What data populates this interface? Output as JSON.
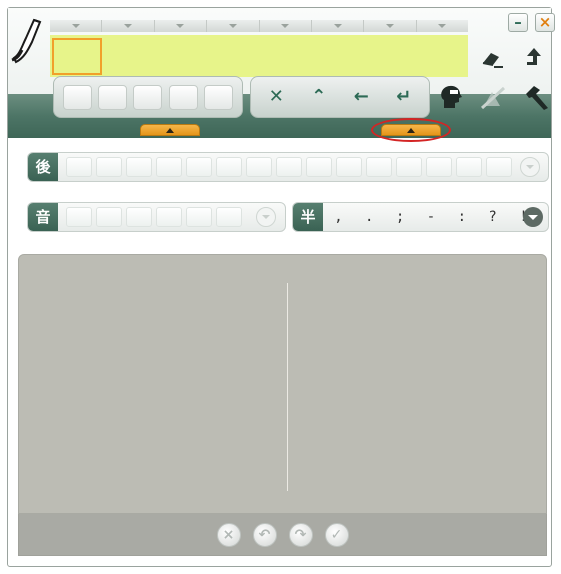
{
  "window": {
    "minimize_label": "–",
    "close_label": "×"
  },
  "candidate_tabs": [
    "",
    "",
    "",
    "",
    "",
    "",
    "",
    ""
  ],
  "input_bar": {
    "value": ""
  },
  "toolbar": {
    "keys": [
      "",
      "",
      "",
      "",
      ""
    ],
    "controls": [
      {
        "glyph": "✕",
        "name": "clear-key"
      },
      {
        "glyph": "⌃",
        "name": "caret-key"
      },
      {
        "glyph": "←",
        "name": "backspace-key"
      },
      {
        "glyph": "↵",
        "name": "enter-key"
      }
    ]
  },
  "rows": {
    "row1_label": "後",
    "row2_label": "音",
    "row2b_label": "半",
    "punctuation": [
      ",",
      ".",
      ";",
      "-",
      ":",
      "?",
      "!"
    ]
  },
  "handwriting": {
    "buttons": [
      "×",
      "↶",
      "↷",
      "✓"
    ]
  },
  "accent_colors": {
    "input_bar": "#e7f48a",
    "cursor_box": "#f1a02a",
    "header_band": "#4d7566",
    "highlight_ring": "#d42424",
    "expand_tab": "#e4951a"
  }
}
